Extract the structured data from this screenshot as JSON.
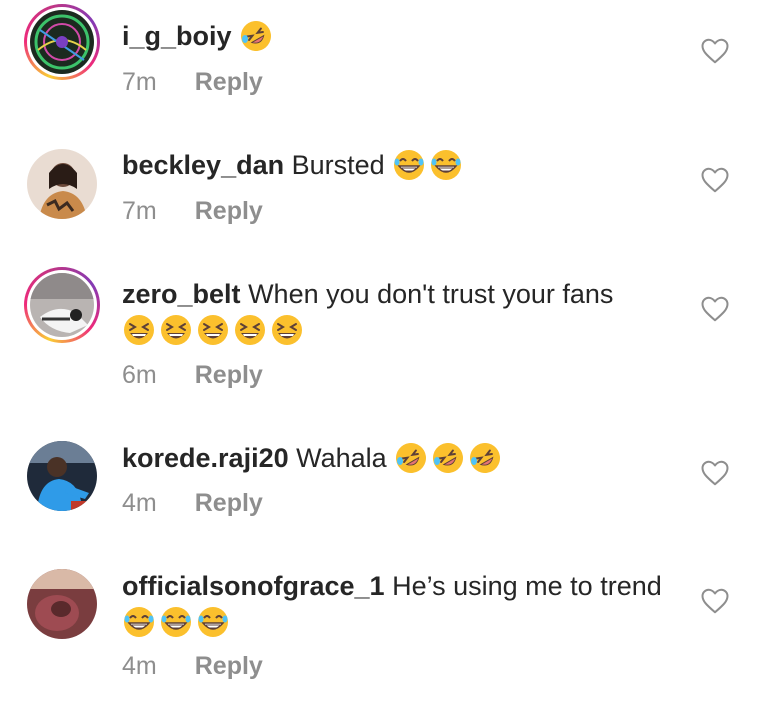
{
  "comments": [
    {
      "username": "i_g_boiy",
      "text": "",
      "emojis": [
        "rofl"
      ],
      "time": "7m",
      "reply_label": "Reply",
      "has_story_ring": true
    },
    {
      "username": "beckley_dan",
      "text": "Bursted",
      "emojis": [
        "grin-sweat",
        "grin-sweat"
      ],
      "time": "7m",
      "reply_label": "Reply",
      "has_story_ring": false
    },
    {
      "username": "zero_belt",
      "text": "When you don't trust your fans",
      "emojis": [
        "laughing",
        "laughing",
        "laughing",
        "laughing",
        "laughing"
      ],
      "time": "6m",
      "reply_label": "Reply",
      "has_story_ring": true
    },
    {
      "username": "korede.raji20",
      "text": "Wahala",
      "emojis": [
        "rofl",
        "rofl",
        "rofl"
      ],
      "time": "4m",
      "reply_label": "Reply",
      "has_story_ring": false
    },
    {
      "username": "officialsonofgrace_1",
      "text": "He’s using me to trend",
      "emojis": [
        "grin-sweat",
        "grin-sweat",
        "grin-sweat"
      ],
      "time": "4m",
      "reply_label": "Reply",
      "has_story_ring": false
    }
  ],
  "colors": {
    "username": "#262626",
    "meta": "#8e8e8e",
    "emoji_face": "#fbc02d",
    "heart_outline": "#8e8e8e"
  },
  "icons": {
    "like": "heart-outline-icon"
  }
}
